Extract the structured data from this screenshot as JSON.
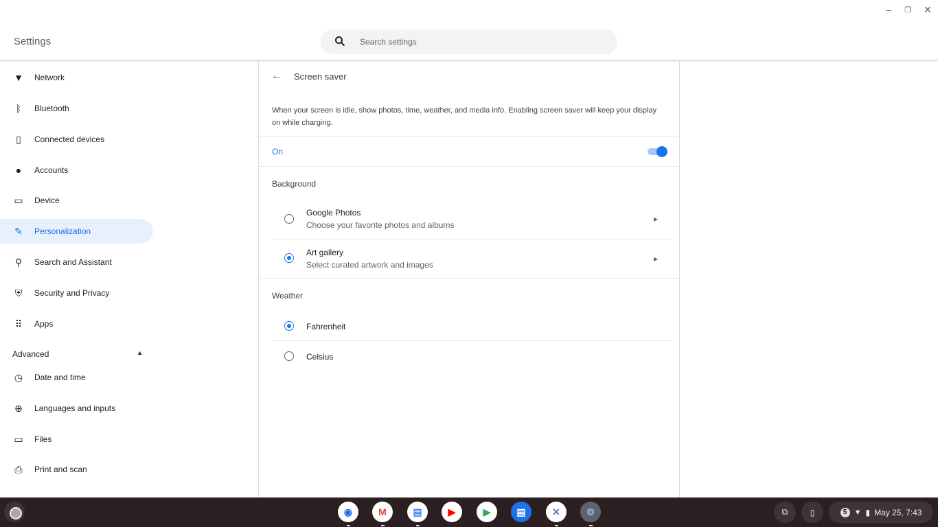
{
  "window": {
    "title": "Settings",
    "minimize": "–",
    "restore": "❐",
    "close": "✕"
  },
  "search": {
    "placeholder": "Search settings"
  },
  "sidebar": {
    "items": [
      {
        "label": "Network",
        "icon": "wifi-icon",
        "glyph": "▼"
      },
      {
        "label": "Bluetooth",
        "icon": "bluetooth-icon",
        "glyph": "ᛒ"
      },
      {
        "label": "Connected devices",
        "icon": "phone-icon",
        "glyph": "▯"
      },
      {
        "label": "Accounts",
        "icon": "person-icon",
        "glyph": "●"
      },
      {
        "label": "Device",
        "icon": "laptop-icon",
        "glyph": "▭"
      },
      {
        "label": "Personalization",
        "icon": "brush-icon",
        "glyph": "✎"
      },
      {
        "label": "Search and Assistant",
        "icon": "search-icon",
        "glyph": "⚲"
      },
      {
        "label": "Security and Privacy",
        "icon": "shield-icon",
        "glyph": "⛨"
      },
      {
        "label": "Apps",
        "icon": "apps-grid-icon",
        "glyph": "⠿"
      }
    ],
    "advanced": "Advanced",
    "advanced_items": [
      {
        "label": "Date and time",
        "icon": "clock-icon",
        "glyph": "◷"
      },
      {
        "label": "Languages and inputs",
        "icon": "globe-icon",
        "glyph": "⊕"
      },
      {
        "label": "Files",
        "icon": "folder-icon",
        "glyph": "▭"
      },
      {
        "label": "Print and scan",
        "icon": "printer-icon",
        "glyph": "⎙"
      }
    ]
  },
  "main": {
    "title": "Screen saver",
    "description": "When your screen is idle, show photos, time, weather, and media info. Enabling screen saver will keep your display on while charging.",
    "toggle_label": "On",
    "toggle_on": true,
    "background_heading": "Background",
    "background_options": [
      {
        "label": "Google Photos",
        "sub": "Choose your favorite photos and albums",
        "selected": false
      },
      {
        "label": "Art gallery",
        "sub": "Select curated artwork and images",
        "selected": true
      }
    ],
    "weather_heading": "Weather",
    "weather_options": [
      {
        "label": "Fahrenheit",
        "selected": true
      },
      {
        "label": "Celsius",
        "selected": false
      }
    ]
  },
  "shelf": {
    "apps": [
      {
        "name": "Chrome",
        "bg": "#ffffff",
        "fg": "#1a73e8",
        "glyph": "◉"
      },
      {
        "name": "Gmail",
        "bg": "#ffffff",
        "fg": "#ea4335",
        "glyph": "M"
      },
      {
        "name": "Docs",
        "bg": "#ffffff",
        "fg": "#4285f4",
        "glyph": "▤"
      },
      {
        "name": "YouTube",
        "bg": "#ffffff",
        "fg": "#ff0000",
        "glyph": "▶"
      },
      {
        "name": "Play Store",
        "bg": "#ffffff",
        "fg": "#34a853",
        "glyph": "▶"
      },
      {
        "name": "Messages",
        "bg": "#1a73e8",
        "fg": "#ffffff",
        "glyph": "▤"
      },
      {
        "name": "Cursive",
        "bg": "#ffffff",
        "fg": "#5b6fb0",
        "glyph": "✕"
      },
      {
        "name": "Settings",
        "bg": "#5f6368",
        "fg": "#8ab4f8",
        "glyph": "⚙"
      }
    ],
    "notification_count": "5",
    "datetime": "May 25, 7:43"
  }
}
